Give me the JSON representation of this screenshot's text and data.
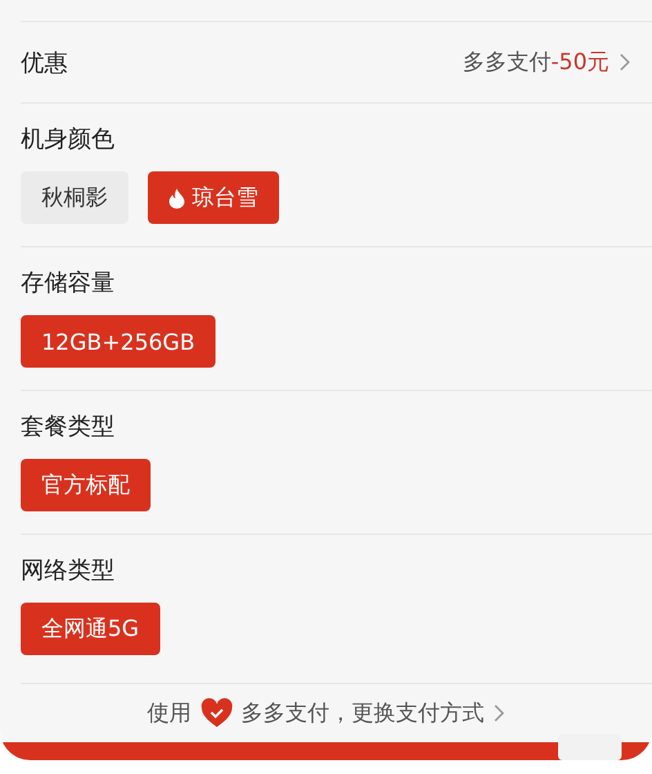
{
  "discount_row": {
    "label": "优惠",
    "value": "多多支付",
    "amount": "-50元"
  },
  "option_groups": [
    {
      "title": "机身颜色",
      "options": [
        {
          "label": "秋桐影",
          "selected": false,
          "hot": false
        },
        {
          "label": "琼台雪",
          "selected": true,
          "hot": true
        }
      ]
    },
    {
      "title": "存储容量",
      "options": [
        {
          "label": "12GB+256GB",
          "selected": true,
          "hot": false
        }
      ]
    },
    {
      "title": "套餐类型",
      "options": [
        {
          "label": "官方标配",
          "selected": true,
          "hot": false
        }
      ]
    },
    {
      "title": "网络类型",
      "options": [
        {
          "label": "全网通5G",
          "selected": true,
          "hot": false
        }
      ]
    }
  ],
  "payment_bar": {
    "prefix": "使用",
    "text": "多多支付，更换支付方式"
  }
}
